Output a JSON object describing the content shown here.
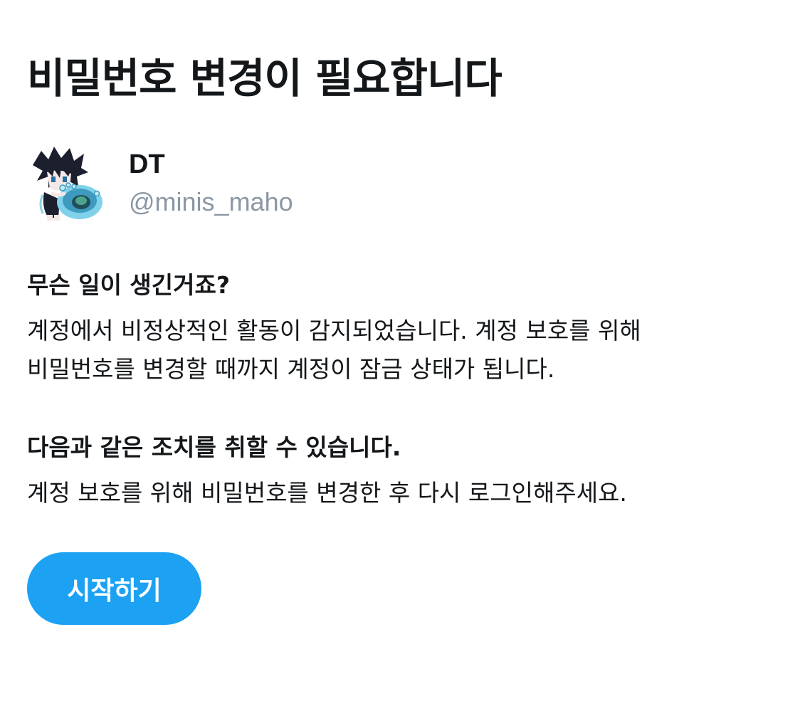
{
  "title": "비밀번호 변경이 필요합니다",
  "profile": {
    "display_name": "DT",
    "handle": "@minis_maho"
  },
  "sections": [
    {
      "heading": "무슨 일이 생긴거죠?",
      "body_lines": [
        "계정에서 비정상적인 활동이 감지되었습니다. 계정 보호를 위해",
        "비밀번호를 변경할 때까지 계정이 잠금 상태가 됩니다."
      ]
    },
    {
      "heading": "다음과 같은 조치를 취할 수 있습니다.",
      "body_lines": [
        "계정 보호를 위해 비밀번호를 변경한 후 다시 로그인해주세요."
      ]
    }
  ],
  "start_button": {
    "label": "시작하기"
  },
  "colors": {
    "accent": "#1da1f2",
    "text": "#14171a",
    "secondary_text": "#8a97a4"
  }
}
